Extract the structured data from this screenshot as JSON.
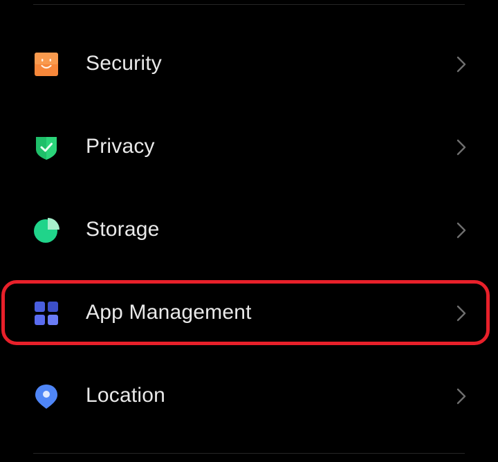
{
  "settings": {
    "items": [
      {
        "label": "Security",
        "icon": "security-face-icon",
        "color": "#f7873a"
      },
      {
        "label": "Privacy",
        "icon": "shield-check-icon",
        "color": "#2bd47a"
      },
      {
        "label": "Storage",
        "icon": "pie-chart-icon",
        "color": "#20d48a"
      },
      {
        "label": "App Management",
        "icon": "app-grid-icon",
        "color": "#5a6cf0"
      },
      {
        "label": "Location",
        "icon": "location-pin-icon",
        "color": "#4f86f7"
      }
    ],
    "highlighted_item": "App Management",
    "highlight_color": "#e8202a"
  }
}
